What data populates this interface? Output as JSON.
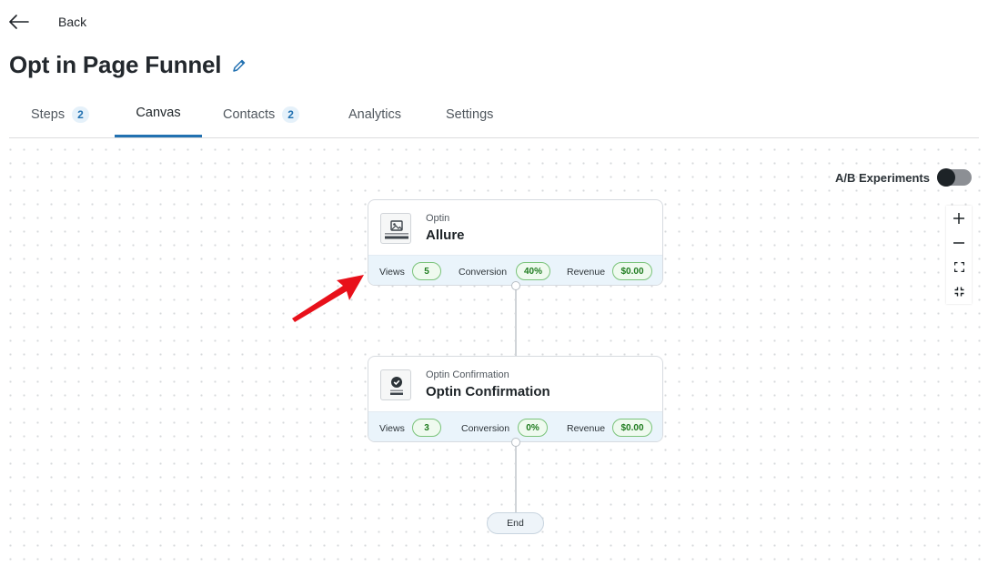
{
  "header": {
    "back_label": "Back",
    "title": "Opt in Page Funnel"
  },
  "tabs": [
    {
      "label": "Steps",
      "count": "2"
    },
    {
      "label": "Canvas"
    },
    {
      "label": "Contacts",
      "count": "2"
    },
    {
      "label": "Analytics"
    },
    {
      "label": "Settings"
    }
  ],
  "active_tab": "Canvas",
  "ab_experiments": {
    "label": "A/B Experiments",
    "enabled": false
  },
  "nodes": [
    {
      "type": "Optin",
      "name": "Allure",
      "icon": "image-icon",
      "stats": {
        "views_label": "Views",
        "views": "5",
        "conversion_label": "Conversion",
        "conversion": "40%",
        "revenue_label": "Revenue",
        "revenue": "$0.00"
      }
    },
    {
      "type": "Optin Confirmation",
      "name": "Optin Confirmation",
      "icon": "check-circle-icon",
      "stats": {
        "views_label": "Views",
        "views": "3",
        "conversion_label": "Conversion",
        "conversion": "0%",
        "revenue_label": "Revenue",
        "revenue": "$0.00"
      }
    }
  ],
  "end_label": "End",
  "zoom_controls": [
    "zoom-in-icon",
    "zoom-out-icon",
    "fit-view-icon",
    "fullscreen-icon"
  ],
  "colors": {
    "accent": "#2271b1",
    "pill_border": "#7ac37a",
    "pill_text": "#1e7b1e",
    "annotation_arrow": "#e8101a"
  }
}
